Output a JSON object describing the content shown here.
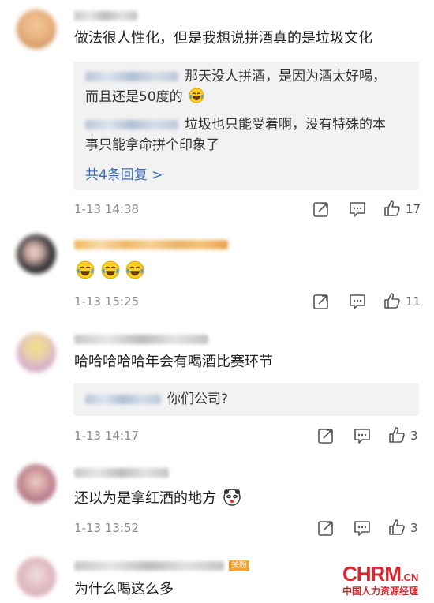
{
  "comments": [
    {
      "text": "做法很人性化，但是我想说拼酒真的是垃圾文化",
      "replies": [
        {
          "text1": "那天没人拼酒，是因为酒太好喝，",
          "text2": "而且还是50度的"
        },
        {
          "text1": "垃圾也只能受着啊，没有特殊的本",
          "text2": "事只能拿命拼个印象了"
        }
      ],
      "more": "共4条回复 >",
      "time": "1-13 14:38",
      "likes": "17"
    },
    {
      "text": "",
      "time": "1-13 15:25",
      "likes": "11"
    },
    {
      "text": "哈哈哈哈哈年会有喝酒比赛环节",
      "replies": [
        {
          "text1": "你们公司?"
        }
      ],
      "time": "1-13 14:17",
      "likes": "3"
    },
    {
      "text": "还以为是拿红酒的地方",
      "time": "1-13 13:52",
      "likes": "3"
    },
    {
      "text": "为什么喝这么多",
      "badge": "关粉"
    }
  ],
  "watermark": {
    "brand": "CHRM",
    "suffix": ".CN",
    "tagline": "中国人力资源经理"
  },
  "icons": {
    "share": "share-icon",
    "comment": "comment-icon",
    "like": "thumbs-up-icon"
  },
  "colors": {
    "link": "#3b6bb5",
    "time": "#8c8c8c",
    "reply_bg": "#f2f2f2",
    "watermark": "#d8262e"
  }
}
